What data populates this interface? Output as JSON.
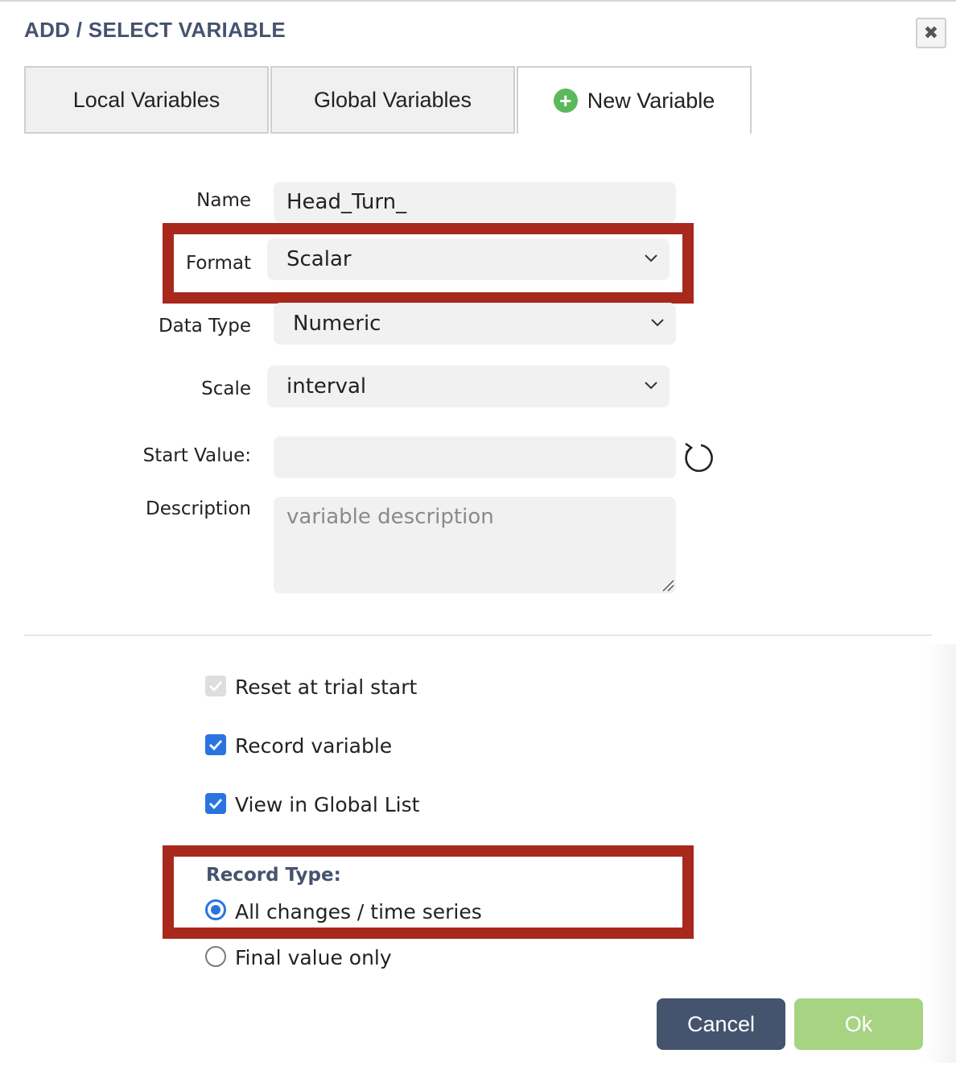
{
  "dialog": {
    "title": "ADD / SELECT VARIABLE",
    "close_icon": "close-icon"
  },
  "tabs": [
    {
      "label": "Local Variables",
      "active": false
    },
    {
      "label": "Global Variables",
      "active": false
    },
    {
      "label": "New Variable",
      "active": true,
      "icon": "plus-circle-icon"
    }
  ],
  "form": {
    "name": {
      "label": "Name",
      "value": "Head_Turn_"
    },
    "format": {
      "label": "Format",
      "value": "Scalar"
    },
    "data_type": {
      "label": "Data Type",
      "value": "Numeric"
    },
    "scale": {
      "label": "Scale",
      "value": "interval"
    },
    "start_value": {
      "label": "Start Value:",
      "value": "",
      "reset_icon": "reset-icon"
    },
    "description": {
      "label": "Description",
      "placeholder": "variable description"
    }
  },
  "options": {
    "reset_at_trial_start": {
      "label": "Reset at trial start",
      "checked": true,
      "disabled": true
    },
    "record_variable": {
      "label": "Record variable",
      "checked": true
    },
    "view_in_global_list": {
      "label": "View in Global List",
      "checked": true
    }
  },
  "record_type": {
    "label": "Record Type:",
    "options": [
      {
        "label": "All changes / time series",
        "selected": true
      },
      {
        "label": "Final value only",
        "selected": false
      }
    ]
  },
  "buttons": {
    "cancel": "Cancel",
    "ok": "Ok"
  },
  "colors": {
    "title": "#45536e",
    "highlight_box": "#a8281c",
    "checkbox": "#2a74e0",
    "cancel_bg": "#44546e",
    "ok_bg": "#a8d382",
    "plus_icon": "#5cb85c"
  }
}
